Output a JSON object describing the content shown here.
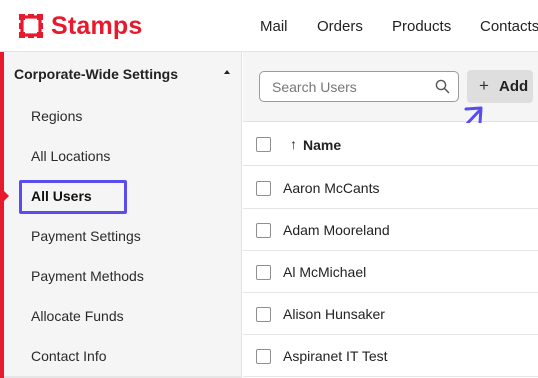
{
  "brand": {
    "name": "Stamps",
    "accent_color": "#e8192c",
    "logo_icon": "stamp-frame-icon"
  },
  "nav": {
    "items": [
      {
        "label": "Mail"
      },
      {
        "label": "Orders"
      },
      {
        "label": "Products"
      },
      {
        "label": "Contacts"
      }
    ]
  },
  "sidebar": {
    "header": "Corporate-Wide Settings",
    "items": [
      {
        "label": "Regions"
      },
      {
        "label": "All Locations"
      },
      {
        "label": "All Users",
        "active": true
      },
      {
        "label": "Payment Settings"
      },
      {
        "label": "Payment Methods"
      },
      {
        "label": "Allocate Funds"
      },
      {
        "label": "Contact Info"
      }
    ]
  },
  "toolbar": {
    "search_placeholder": "Search Users",
    "search_icon": "search-icon",
    "add_label": "Add",
    "add_icon": "plus-icon"
  },
  "table": {
    "columns": [
      {
        "label": "Name",
        "sort": "ascending"
      }
    ],
    "rows": [
      {
        "name": "Aaron McCants"
      },
      {
        "name": "Adam Mooreland"
      },
      {
        "name": "Al McMichael"
      },
      {
        "name": "Alison Hunsaker"
      },
      {
        "name": "Aspiranet IT Test"
      }
    ]
  },
  "annotation": {
    "highlight_color": "#5b4cf0"
  }
}
